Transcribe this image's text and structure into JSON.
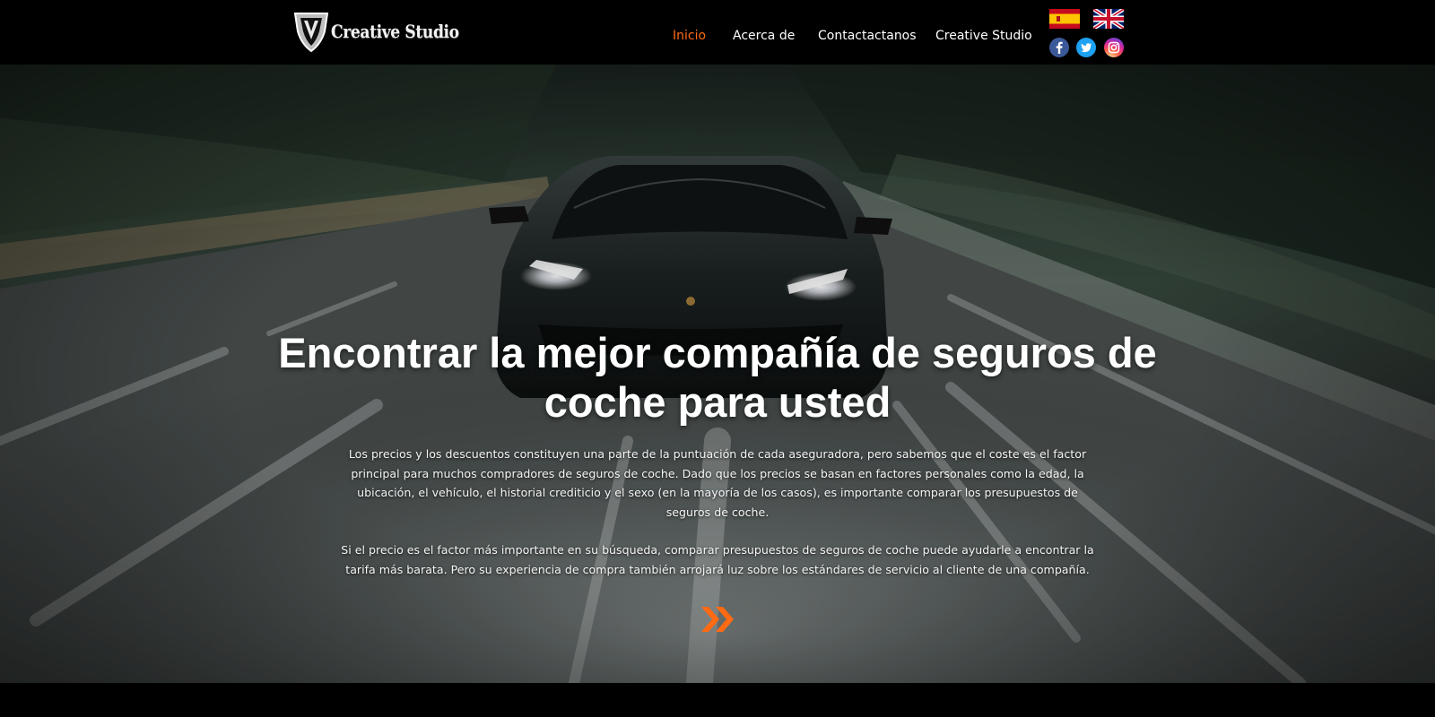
{
  "header": {
    "logo_text": "Creative Studio",
    "nav": [
      {
        "label": "Inicio",
        "active": true
      },
      {
        "label": "Acerca de",
        "active": false
      },
      {
        "label": "Contactactanos",
        "active": false
      },
      {
        "label": "Creative Studio",
        "active": false
      }
    ],
    "languages": [
      "es-flag-icon",
      "uk-flag-icon"
    ],
    "social": [
      "facebook-icon",
      "twitter-icon",
      "instagram-icon"
    ]
  },
  "hero": {
    "title": "Encontrar la mejor compañía de seguros de coche para usted",
    "paragraph_1": "Los precios y los descuentos constituyen una parte de la puntuación de cada aseguradora, pero sabemos que el coste es el factor principal para muchos compradores de seguros de coche. Dado que los precios se basan en factores personales como la edad, la ubicación, el vehículo, el historial crediticio y el sexo (en la mayoría de los casos), es importante comparar los presupuestos de seguros de coche.",
    "paragraph_2": "Si el precio es el factor más importante en su búsqueda, comparar presupuestos de seguros de coche puede ayudarle a encontrar la tarifa más barata. Pero su experiencia de compra también arrojará luz sobre los estándares de servicio al cliente de una compañía.",
    "arrow_icon": "double-chevron-right-icon"
  },
  "colors": {
    "accent": "#ff6a13",
    "header_bg": "#000000",
    "text": "#ffffff"
  }
}
